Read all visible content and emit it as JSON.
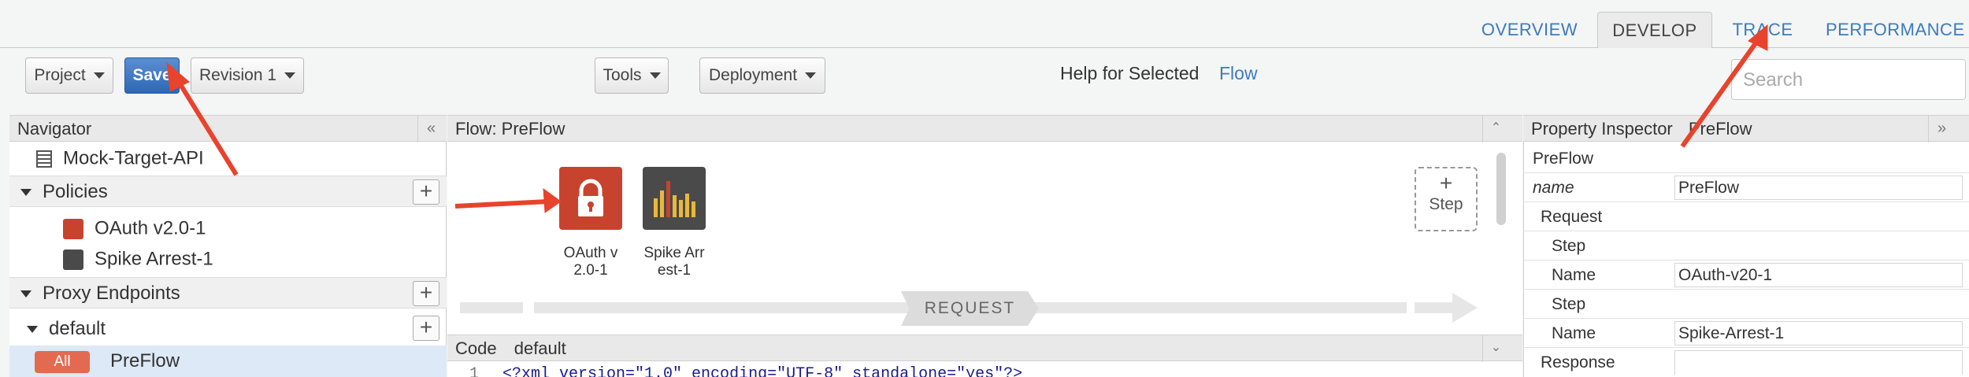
{
  "tabs": {
    "overview": "OVERVIEW",
    "develop": "DEVELOP",
    "trace": "TRACE",
    "performance": "PERFORMANCE"
  },
  "toolbar": {
    "project": "Project",
    "save": "Save",
    "revision": "Revision 1",
    "tools": "Tools",
    "deployment": "Deployment",
    "help_text": "Help for Selected",
    "help_link": "Flow",
    "search_placeholder": "Search"
  },
  "navigator": {
    "title": "Navigator",
    "collapse": "«",
    "api": "Mock-Target-API",
    "policies": "Policies",
    "policy_items": [
      "OAuth v2.0-1",
      "Spike Arrest-1"
    ],
    "proxy_endpoints": "Proxy Endpoints",
    "default": "default",
    "all_badge": "All",
    "preflow": "PreFlow"
  },
  "flow": {
    "title": "Flow: PreFlow",
    "policy1_label_1": "OAuth v",
    "policy1_label_2": "2.0-1",
    "policy2_label_1": "Spike Arr",
    "policy2_label_2": "est-1",
    "step_plus": "+",
    "step_label": "Step",
    "request": "REQUEST",
    "code_label": "Code",
    "code_name": "default",
    "code_line_no": "1",
    "code_line": "<?xml version=\"1.0\" encoding=\"UTF-8\" standalone=\"yes\"?>"
  },
  "inspector": {
    "title": "Property Inspector",
    "subject": "PreFlow",
    "expand": "»",
    "rows": {
      "section": "PreFlow",
      "name_label": "name",
      "name_value": "PreFlow",
      "request": "Request",
      "step1": "Step",
      "step1_name_label": "Name",
      "step1_name_value": "OAuth-v20-1",
      "step2": "Step",
      "step2_name_label": "Name",
      "step2_name_value": "Spike-Arrest-1",
      "response": "Response"
    }
  },
  "colors": {
    "accent": "#3b7bbf",
    "save": "#2e67b3",
    "oauth_icon": "#c8432e",
    "spike_icon": "#4a4a4a",
    "annotation_arrow": "#e8432d"
  }
}
